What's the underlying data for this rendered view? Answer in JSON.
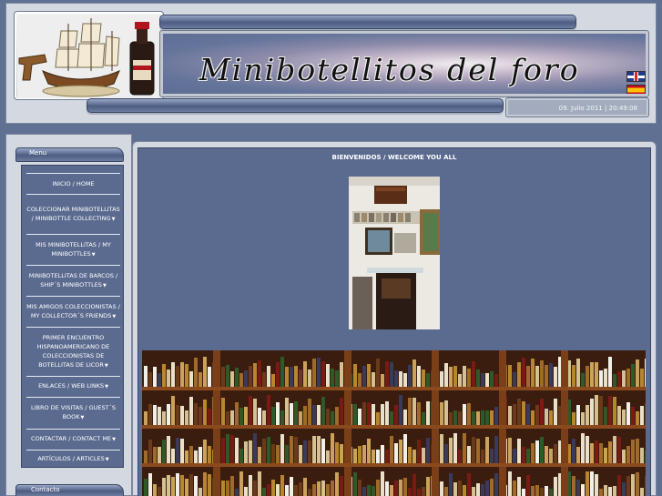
{
  "header": {
    "site_title": "Minibotellitos del foro",
    "date_time": "09. Julio 2011 | 20:49:08",
    "languages": [
      {
        "name": "english-flag-icon",
        "colors": [
          "#1f3c8c",
          "#ffffff",
          "#d52b1e"
        ]
      },
      {
        "name": "spanish-flag-icon",
        "colors": [
          "#c60b1e",
          "#ffc400"
        ]
      }
    ]
  },
  "sidebar": {
    "menu_label": "Menu",
    "contact_label": "Contacto",
    "items": [
      {
        "label": "INICIO / HOME",
        "submenu": false
      },
      {
        "label": "COLECCIONAR MINIBOTELLITAS / MINIBOTTLE COLLECTING",
        "submenu": true
      },
      {
        "label": "MIS MINIBOTELLITAS / MY MINIBOTTLES",
        "submenu": true
      },
      {
        "label": "MINIBOTELLITAS DE BARCOS / SHIP´S MINIBOTTLES",
        "submenu": true
      },
      {
        "label": "MIS AMIGOS COLECCIONISTAS / MY COLLECTOR´S FRIENDS",
        "submenu": true
      },
      {
        "label": "PRIMER ENCUENTRO HISPANOAMERICANO DE COLECCIONISTAS DE BOTELLITAS DE LICOR",
        "submenu": true
      },
      {
        "label": "ENLACES / WEB LINKS",
        "submenu": true
      },
      {
        "label": "LIBRO DE VISITAS / GUEST´S BOOK",
        "submenu": true
      },
      {
        "label": "CONTACTAR / CONTACT ME",
        "submenu": true
      },
      {
        "label": "ARTÍCULOS / ARTICLES",
        "submenu": true
      }
    ]
  },
  "main": {
    "welcome_text": "BIENVENIDOS / WELCOME YOU ALL"
  },
  "colors": {
    "page_bg": "#5f7093",
    "frame_bg": "#d4d8e0",
    "panel_bg": "#5b6b90",
    "text": "#ffffff"
  }
}
